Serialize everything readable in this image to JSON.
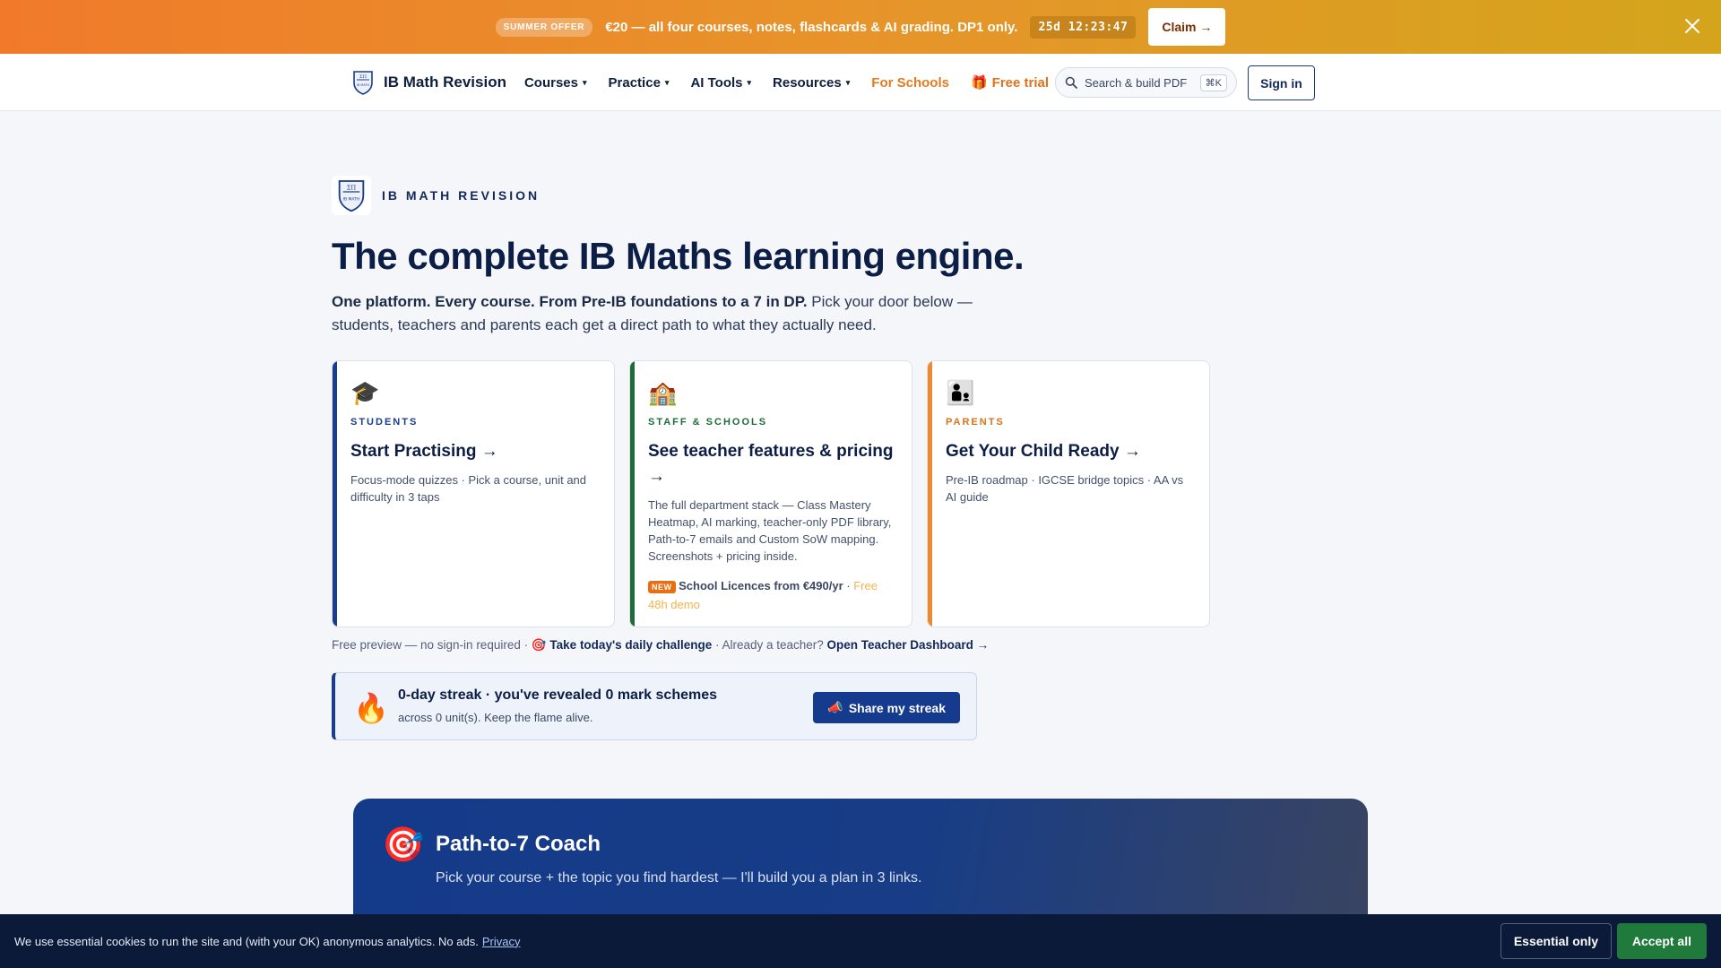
{
  "promo": {
    "badge": "SUMMER OFFER",
    "text": "€20 — all four courses, notes, flashcards & AI grading. DP1 only.",
    "timer": "25d 12:23:47",
    "claim_label": "Claim →",
    "close_icon": "close-icon"
  },
  "header": {
    "brand": "IB Math Revision",
    "nav": [
      {
        "label": "Courses",
        "caret": "▾"
      },
      {
        "label": "Practice",
        "caret": "▾"
      },
      {
        "label": "AI Tools",
        "caret": "▾"
      },
      {
        "label": "Resources",
        "caret": "▾"
      }
    ],
    "for_schools": "For Schools",
    "free_trial": "Free trial",
    "gift_icon": "🎁",
    "search_placeholder": "Search & build PDF",
    "search_kbd": "⌘K",
    "signin": "Sign in"
  },
  "hero": {
    "eyebrow": "IB MATH REVISION",
    "headline": "The complete IB Maths learning engine.",
    "lead_strong": "One platform. Every course. From Pre-IB foundations to a 7 in DP.",
    "lead_rest": " Pick your door below — students, teachers and parents each get a direct path to what they actually need."
  },
  "cards": [
    {
      "icon": "🎓",
      "tag": "STUDENTS",
      "title": "Start Practising →",
      "desc": "Focus-mode quizzes · Pick a course, unit and difficulty in 3 taps"
    },
    {
      "icon": "🏫",
      "tag": "STAFF & SCHOOLS",
      "title": "See teacher features & pricing →",
      "desc": "The full department stack — Class Mastery Heatmap, AI marking, teacher-only PDF library, Path-to-7 emails and Custom SoW mapping. Screenshots + pricing inside.",
      "new_badge": "NEW",
      "foot_strong": "School Licences from €490/yr",
      "foot_sep": " · ",
      "foot_demo": "Free 48h demo"
    },
    {
      "icon": "👨‍👦",
      "tag": "PARENTS",
      "title": "Get Your Child Ready →",
      "desc": "Pre-IB roadmap · IGCSE bridge topics · AA vs AI guide"
    }
  ],
  "preview": {
    "prefix": "Free preview — no sign-in required · ",
    "challenge_icon": "🎯",
    "challenge": "Take today's daily challenge",
    "middle": " · Already a teacher? ",
    "dashboard": "Open Teacher Dashboard →"
  },
  "streak": {
    "icon": "🔥",
    "title": "0-day streak · you've revealed 0 mark schemes",
    "sub": "across 0 unit(s). Keep the flame alive.",
    "button_icon": "📣",
    "button": "Share my streak"
  },
  "coach": {
    "icon": "🎯",
    "title": "Path-to-7 Coach",
    "sub": "Pick your course + the topic you find hardest — I'll build you a plan in 3 links."
  },
  "cookie": {
    "text": "We use essential cookies to run the site and (with your OK) anonymous analytics. No ads.",
    "privacy": "Privacy",
    "essential": "Essential only",
    "accept": "Accept all"
  },
  "colors": {
    "navy": "#0c1e45",
    "accent_orange": "#e47a1d",
    "accent_green": "#1f6b3a",
    "accent_blue": "#1a3c8c"
  }
}
